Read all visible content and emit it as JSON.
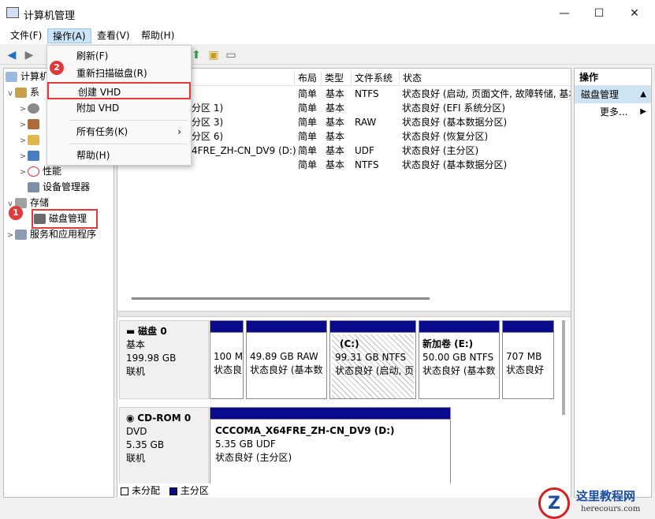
{
  "window": {
    "title": "计算机管理",
    "min": "—",
    "max": "☐",
    "close": "✕"
  },
  "menubar": [
    "文件(F)",
    "操作(A)",
    "查看(V)",
    "帮助(H)"
  ],
  "tree": {
    "root": "计算机",
    "system_short": "系",
    "items_partial": [
      "",
      "",
      "",
      ""
    ],
    "performance": "性能",
    "device_manager": "设备管理器",
    "storage": "存储",
    "disk_management": "磁盘管理",
    "services": "服务和应用程序"
  },
  "volumes": {
    "headers": [
      "布局",
      "类型",
      "文件系统",
      "状态"
    ],
    "rows": [
      {
        "name": "",
        "layout": "简单",
        "type": "基本",
        "fs": "NTFS",
        "status": "状态良好 (启动, 页面文件, 故障转储, 基本"
      },
      {
        "name": "分区 1)",
        "layout": "简单",
        "type": "基本",
        "fs": "",
        "status": "状态良好 (EFI 系统分区)"
      },
      {
        "name": "分区 3)",
        "layout": "简单",
        "type": "基本",
        "fs": "RAW",
        "status": "状态良好 (基本数据分区)"
      },
      {
        "name": "分区 6)",
        "layout": "简单",
        "type": "基本",
        "fs": "",
        "status": "状态良好 (恢复分区)"
      },
      {
        "name": "4FRE_ZH-CN_DV9 (D:)",
        "layout": "简单",
        "type": "基本",
        "fs": "UDF",
        "status": "状态良好 (主分区)"
      },
      {
        "name": "",
        "layout": "简单",
        "type": "基本",
        "fs": "NTFS",
        "status": "状态良好 (基本数据分区)"
      }
    ]
  },
  "disks": [
    {
      "name": "磁盘 0",
      "kind": "基本",
      "size": "199.98 GB",
      "state": "联机",
      "partitions": [
        {
          "label": "",
          "size": "100 M",
          "status": "状态良"
        },
        {
          "label": "",
          "size": "49.89 GB RAW",
          "status": "状态良好 (基本数"
        },
        {
          "label": "(C:)",
          "size": "99.31 GB NTFS",
          "status": "状态良好 (启动, 页"
        },
        {
          "label": "新加卷 (E:)",
          "size": "50.00 GB NTFS",
          "status": "状态良好 (基本数"
        },
        {
          "label": "",
          "size": "707 MB",
          "status": "状态良好"
        }
      ]
    },
    {
      "name": "CD-ROM 0",
      "kind": "DVD",
      "size": "5.35 GB",
      "state": "联机",
      "partitions": [
        {
          "label": "CCCOMA_X64FRE_ZH-CN_DV9 (D:)",
          "size": "5.35 GB UDF",
          "status": "状态良好 (主分区)"
        }
      ]
    }
  ],
  "legend": {
    "unallocated": "未分配",
    "primary": "主分区"
  },
  "actions": {
    "header": "操作",
    "section": "磁盘管理",
    "more": "更多..."
  },
  "dropdown": {
    "items": [
      "刷新(F)",
      "重新扫描磁盘(R)",
      "创建 VHD",
      "附加 VHD",
      "所有任务(K)",
      "帮助(H)"
    ],
    "submenu_arrow": "›"
  },
  "badges": {
    "one": "1",
    "two": "2"
  },
  "watermark": {
    "text": "这里教程网",
    "url": "herecours.com"
  },
  "colors": {
    "primary_partition": "#0a0a8c",
    "highlight": "#e03a3a",
    "selection": "#cde4f5"
  }
}
